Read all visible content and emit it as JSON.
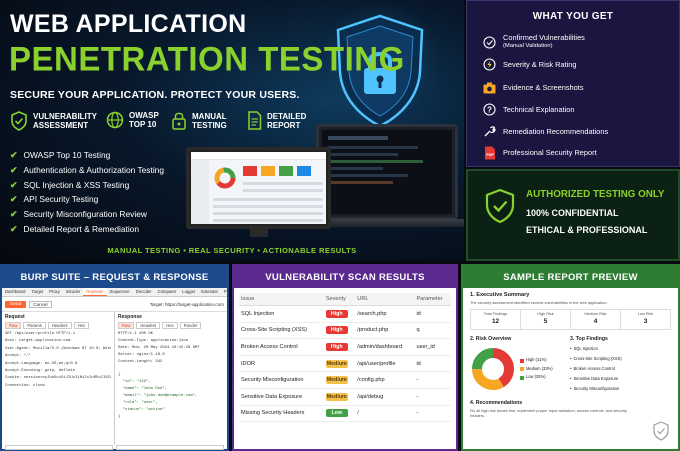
{
  "hero": {
    "title_line1": "WEB APPLICATION",
    "title_line2": "PENETRATION TESTING",
    "tagline": "SECURE YOUR APPLICATION. PROTECT YOUR USERS.",
    "features": [
      {
        "line1": "VULNERABILITY",
        "line2": "ASSESSMENT",
        "icon": "shield-check-icon"
      },
      {
        "line1": "OWASP",
        "line2": "TOP 10",
        "icon": "globe-icon"
      },
      {
        "line1": "MANUAL",
        "line2": "TESTING",
        "icon": "lock-icon"
      },
      {
        "line1": "DETAILED",
        "line2": "REPORT",
        "icon": "document-icon"
      }
    ],
    "checklist": [
      "OWASP Top 10 Testing",
      "Authentication & Authorization Testing",
      "SQL Injection & XSS Testing",
      "API Security Testing",
      "Security Misconfiguration Review",
      "Detailed Report & Remediation"
    ],
    "bottom_line": "MANUAL TESTING  •  REAL SECURITY  •  ACTIONABLE RESULTS"
  },
  "what_you_get": {
    "title": "WHAT YOU GET",
    "items": [
      {
        "label": "Confirmed Vulnerabilities",
        "sub": "(Manual Validation)",
        "icon": "target-icon"
      },
      {
        "label": "Severity & Risk Rating",
        "sub": "",
        "icon": "lightning-icon"
      },
      {
        "label": "Evidence & Screenshots",
        "sub": "",
        "icon": "camera-icon"
      },
      {
        "label": "Technical Explanation",
        "sub": "",
        "icon": "question-icon"
      },
      {
        "label": "Remediation Recommendations",
        "sub": "",
        "icon": "wrench-icon"
      },
      {
        "label": "Professional Security Report",
        "sub": "",
        "icon": "pdf-icon"
      }
    ]
  },
  "authorized": {
    "title": "AUTHORIZED TESTING ONLY",
    "line1": "100% CONFIDENTIAL",
    "line2": "ETHICAL & PROFESSIONAL"
  },
  "burp": {
    "title": "BURP SUITE – REQUEST & RESPONSE",
    "tabs": [
      "Dashboard",
      "Target",
      "Proxy",
      "Intruder",
      "Repeater",
      "Sequencer",
      "Decoder",
      "Comparer",
      "Logger",
      "Extender",
      "Project"
    ],
    "send_label": "Send",
    "cancel_label": "Cancel",
    "target": "Target: https://target-application.com",
    "request_label": "Request",
    "response_label": "Response",
    "request_subtabs": [
      "Raw",
      "Params",
      "Headers",
      "Hex"
    ],
    "response_subtabs": [
      "Raw",
      "Headers",
      "Hex",
      "Render"
    ],
    "request_lines": [
      "GET /api/user/profile HTTP/1.1",
      "Host: target-application.com",
      "User-Agent: Mozilla/5.0 (Windows NT 10.0; Win64; x64)",
      "Accept: */*",
      "Accept-Language: en-US,en;q=0.9",
      "Accept-Encoding: gzip, deflate",
      "Cookie: session=eyJhbGciOiJIUzI1NiIsInR5cCI6IkpXVCJ9",
      "Connection: close"
    ],
    "response_lines": [
      "HTTP/1.1 200 OK",
      "Content-Type: application/json",
      "Date: Mon, 20 May 2024 10:15:28 GMT",
      "Server: nginx/1.18.0",
      "Content-Length: 342",
      "",
      "{",
      "  \"id\": \"123\",",
      "  \"name\": \"John Doe\",",
      "  \"email\": \"john.doe@example.com\",",
      "  \"role\": \"user\",",
      "  \"status\": \"active\"",
      "}"
    ]
  },
  "vuln": {
    "title": "VULNERABILITY SCAN RESULTS",
    "columns": [
      "Issue",
      "Severity",
      "URL",
      "Parameter"
    ],
    "rows": [
      {
        "issue": "SQL Injection",
        "severity": "High",
        "url": "/search.php",
        "param": "id"
      },
      {
        "issue": "Cross-Site Scripting (XSS)",
        "severity": "High",
        "url": "/product.php",
        "param": "q"
      },
      {
        "issue": "Broken Access Control",
        "severity": "High",
        "url": "/admin/dashboard",
        "param": "user_id"
      },
      {
        "issue": "IDOR",
        "severity": "Medium",
        "url": "/api/user/profile",
        "param": "id"
      },
      {
        "issue": "Security Misconfiguration",
        "severity": "Medium",
        "url": "/config.php",
        "param": "-"
      },
      {
        "issue": "Sensitive Data Exposure",
        "severity": "Medium",
        "url": "/api/debug",
        "param": "-"
      },
      {
        "issue": "Missing Security Headers",
        "severity": "Low",
        "url": "/",
        "param": "-"
      }
    ]
  },
  "report": {
    "title": "SAMPLE REPORT PREVIEW",
    "s1_title": "1. Executive Summary",
    "s1_text": "The security assessment identified several vulnerabilities in the web application.",
    "stats": [
      {
        "label": "Total Findings",
        "value": "12"
      },
      {
        "label": "High Risk",
        "value": "5"
      },
      {
        "label": "Medium Risk",
        "value": "4"
      },
      {
        "label": "Low Risk",
        "value": "3"
      }
    ],
    "s2_title": "2. Risk Overview",
    "s3_title": "3. Top Findings",
    "legend": [
      {
        "label": "High (41%)",
        "color": "#e53935",
        "value": 41
      },
      {
        "label": "Medium (33%)",
        "color": "#f5a623",
        "value": 33
      },
      {
        "label": "Low (25%)",
        "color": "#43a047",
        "value": 25
      }
    ],
    "top_findings": [
      "SQL Injection",
      "Cross-Site Scripting (XSS)",
      "Broken Access Control",
      "Sensitive Data Exposure",
      "Security Misconfiguration"
    ],
    "s4_title": "4. Recommendations",
    "s4_text": "Fix all high risk issues first, implement proper input validation, access controls, and security headers."
  },
  "colors": {
    "accent_green": "#8bd12d",
    "high": "#e53935",
    "medium": "#f5a623",
    "low": "#43a047"
  }
}
